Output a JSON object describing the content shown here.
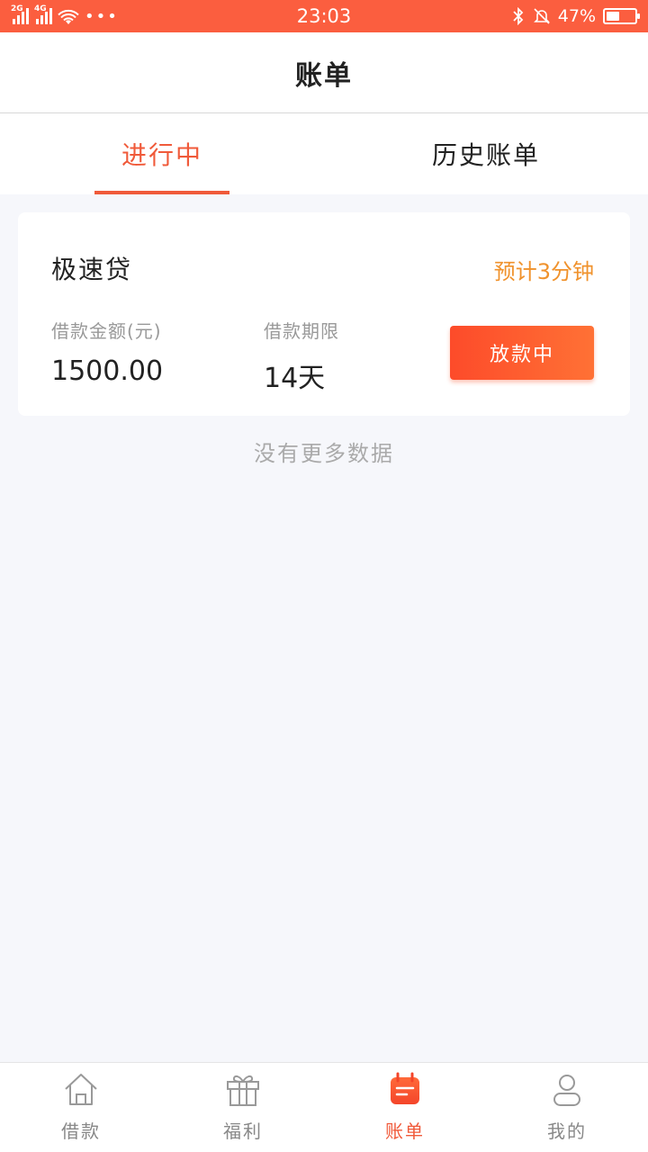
{
  "status_bar": {
    "net1": "2G",
    "net2": "4G",
    "more": "•••",
    "time": "23:03",
    "battery_text": "47%",
    "battery_level": 0.47
  },
  "header": {
    "title": "账单"
  },
  "tabs": [
    {
      "label": "进行中",
      "active": true
    },
    {
      "label": "历史账单",
      "active": false
    }
  ],
  "card": {
    "product": "极速贷",
    "eta": "预计3分钟",
    "amount_label": "借款金额(元)",
    "amount_value": "1500.00",
    "term_label": "借款期限",
    "term_value": "14天",
    "status_button": "放款中"
  },
  "empty_hint": "没有更多数据",
  "bottom_nav": [
    {
      "label": "借款",
      "icon": "home-icon"
    },
    {
      "label": "福利",
      "icon": "gift-icon"
    },
    {
      "label": "账单",
      "icon": "bill-icon",
      "active": true
    },
    {
      "label": "我的",
      "icon": "user-icon"
    }
  ],
  "colors": {
    "accent": "#f05a3a",
    "status_bar": "#fb5e3f",
    "eta": "#f0922c"
  }
}
